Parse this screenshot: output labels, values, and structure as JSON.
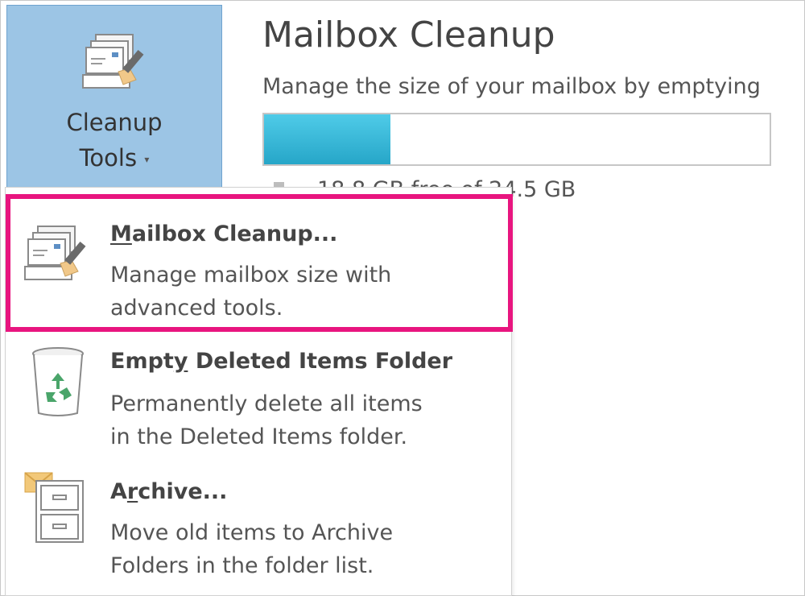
{
  "backstage": {
    "title": "Mailbox Cleanup",
    "description": "Manage the size of your mailbox by emptying",
    "usage_fraction": 0.25,
    "free_text": "18.8 GB free of 24.5 GB",
    "colors": {
      "bar_fill": "#30b4d6",
      "highlight": "#e8157f",
      "button_bg": "#9cc5e5"
    }
  },
  "ribbon": {
    "cleanup_tools_line1": "Cleanup",
    "cleanup_tools_line2": "Tools",
    "caret": "▾"
  },
  "menu": {
    "items": [
      {
        "label_key": "M",
        "label_rest": "ailbox Cleanup...",
        "line1": "Manage mailbox size with",
        "line2": "advanced tools.",
        "icon": "mailbox-cleanup-icon"
      },
      {
        "label_pre": "Empt",
        "label_key": "y",
        "label_rest": " Deleted Items Folder",
        "line1": "Permanently delete all items",
        "line2": "in the Deleted Items folder.",
        "icon": "recycle-bin-icon"
      },
      {
        "label_pre": "A",
        "label_key": "r",
        "label_rest": "chive...",
        "line1": "Move old items to Archive",
        "line2": "Folders in the folder list.",
        "icon": "archive-cabinet-icon"
      }
    ]
  }
}
